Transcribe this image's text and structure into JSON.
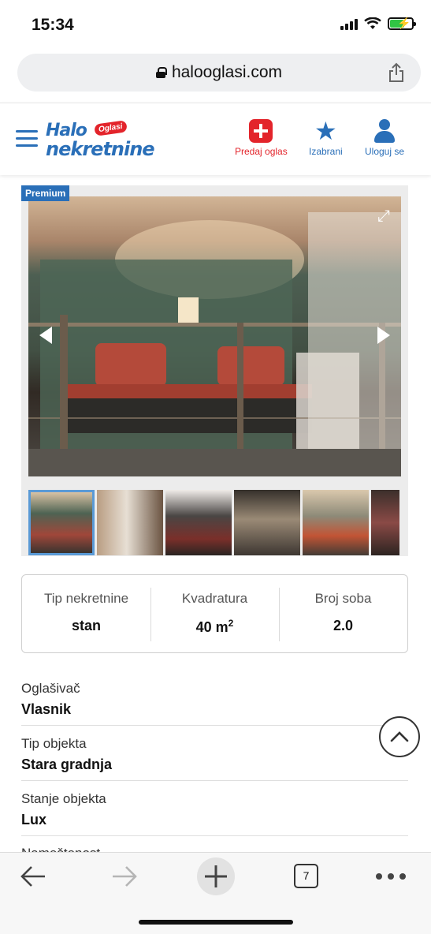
{
  "status_bar": {
    "time": "15:34"
  },
  "browser": {
    "url": "halooglasi.com",
    "tab_count": "7"
  },
  "header": {
    "logo_halo": "Halo",
    "logo_oglasi": "Oglasi",
    "logo_nekretnine": "nekretnine",
    "actions": [
      {
        "label": "Predaj oglas",
        "icon": "add-icon"
      },
      {
        "label": "Izabrani",
        "icon": "star-icon"
      },
      {
        "label": "Uloguj se",
        "icon": "user-icon"
      }
    ]
  },
  "gallery": {
    "badge": "Premium"
  },
  "summary": [
    {
      "label": "Tip nekretnine",
      "value": "stan"
    },
    {
      "label": "Kvadratura",
      "value": "40 m",
      "unit_sup": "2"
    },
    {
      "label": "Broj soba",
      "value": "2.0"
    }
  ],
  "details": [
    {
      "label": "Oglašivač",
      "value": "Vlasnik"
    },
    {
      "label": "Tip objekta",
      "value": "Stara gradnja"
    },
    {
      "label": "Stanje objekta",
      "value": "Lux"
    }
  ],
  "partial_label": "Nameštenost",
  "colors": {
    "brand_blue": "#2a6fb8",
    "brand_red": "#e3242b"
  }
}
